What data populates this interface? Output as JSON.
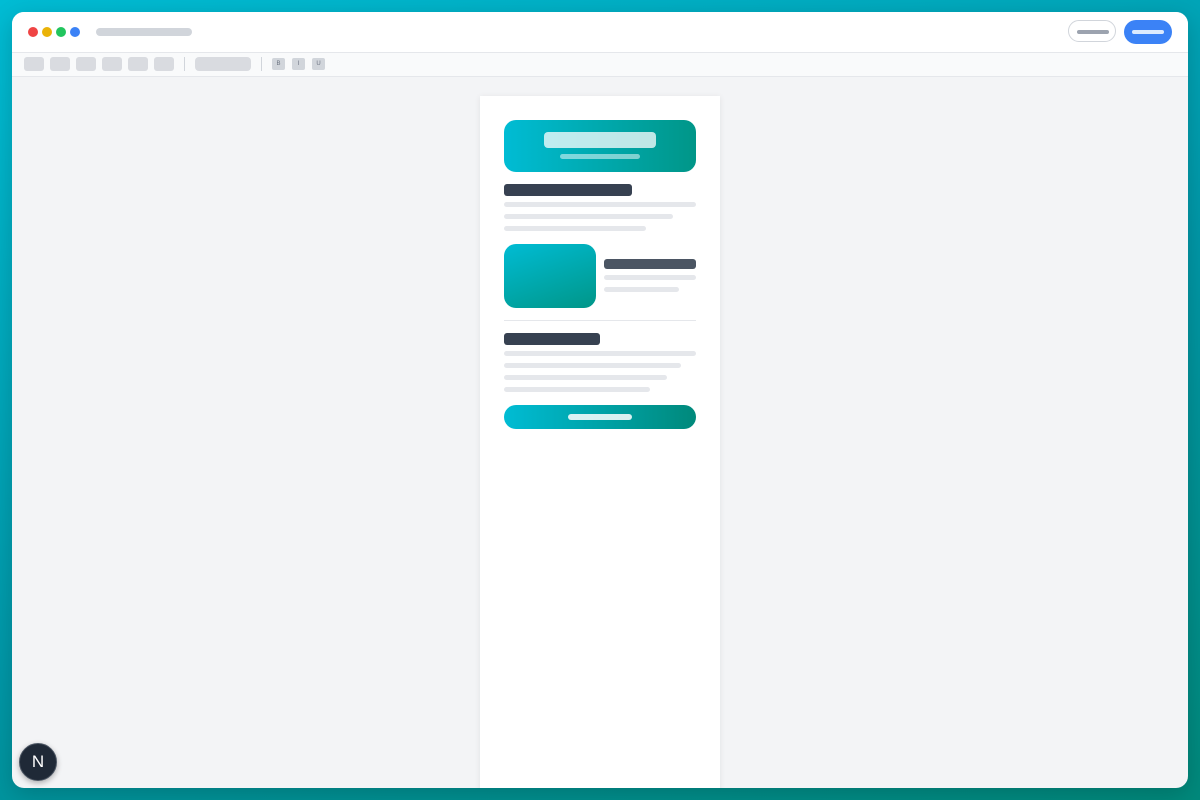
{
  "colors": {
    "accent_start": "#00bcd4",
    "accent_end": "#009688",
    "primary_button": "#3b82f6",
    "heading": "#374151",
    "window_close": "#ef4444",
    "window_minimize": "#eab308",
    "window_maximize": "#22c55e",
    "window_extra": "#3b82f6"
  },
  "toolbar": {
    "format_buttons": [
      "B",
      "I",
      "U"
    ]
  },
  "badge": {
    "letter": "N"
  },
  "icons": {
    "badge": "nextjs-logo-icon"
  }
}
